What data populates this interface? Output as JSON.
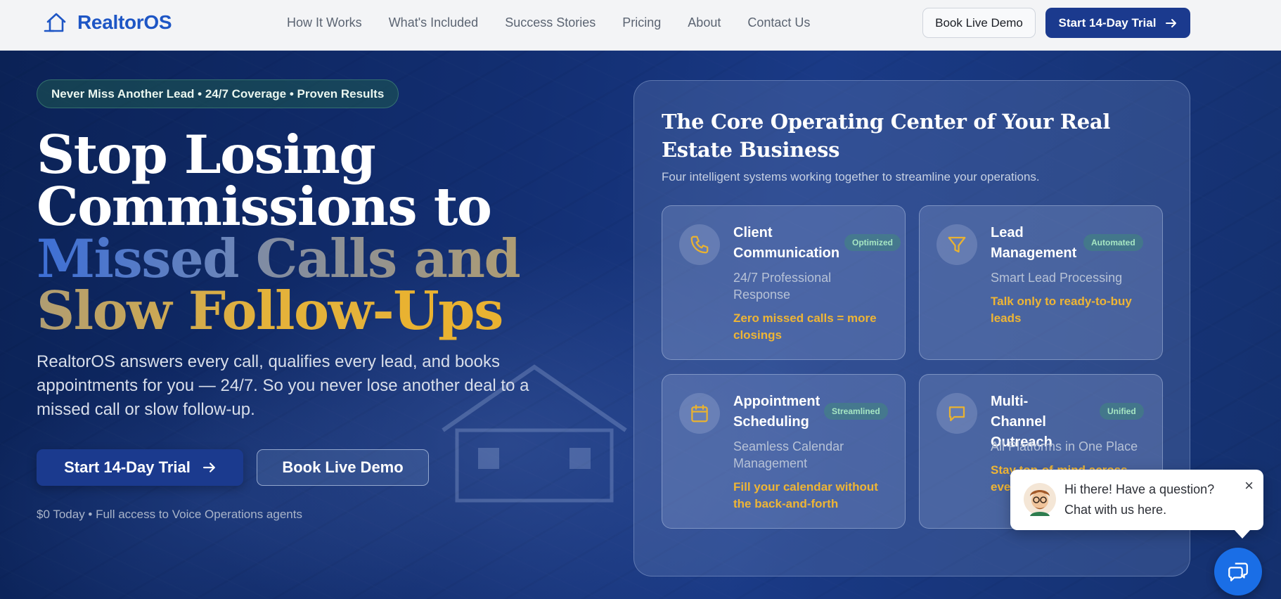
{
  "nav": {
    "brand": "RealtorOS",
    "links": [
      "How It Works",
      "What's Included",
      "Success Stories",
      "Pricing",
      "About",
      "Contact Us"
    ],
    "demo_label": "Book Live Demo",
    "trial_label": "Start 14-Day Trial"
  },
  "hero": {
    "pill": "Never Miss Another Lead • 24/7 Coverage • Proven Results",
    "headline": {
      "part1": "Stop Losing Commissions to ",
      "part2": "Missed",
      "part3": " Calls and Slow Follow-",
      "part4": "Ups"
    },
    "subtext": "RealtorOS answers every call, qualifies every lead, and books appointments for you — 24/7. So you never lose another deal to a missed call or slow follow-up.",
    "trial_label": "Start 14-Day Trial",
    "demo_label": "Book Live Demo",
    "fine_print": "$0 Today • Full access to Voice Operations agents"
  },
  "panel": {
    "title": "The Core Operating Center of Your Real Estate Business",
    "subtitle": "Four intelligent systems working together to streamline your operations.",
    "cards": [
      {
        "title": "Client Communication",
        "badge": "Optimized",
        "sub": "24/7 Professional Response",
        "benefit": "Zero missed calls = more closings",
        "icon": "phone-icon"
      },
      {
        "title": "Lead Management",
        "badge": "Automated",
        "sub": "Smart Lead Processing",
        "benefit": "Talk only to ready-to-buy leads",
        "icon": "filter-icon"
      },
      {
        "title": "Appointment Scheduling",
        "badge": "Streamlined",
        "sub": "Seamless Calendar Management",
        "benefit": "Fill your calendar without the back-and-forth",
        "icon": "calendar-icon"
      },
      {
        "title": "Multi-Channel Outreach",
        "badge": "Unified",
        "sub": "All Platforms in One Place",
        "benefit": "Stay top-of-mind across every channel",
        "icon": "message-icon"
      }
    ]
  },
  "chat": {
    "message": "Hi there! Have a question? Chat with us here.",
    "close": "×"
  },
  "colors": {
    "brand": "#1e56c5",
    "primary_button": "#1b3a8e",
    "accent_gold": "#e9b231",
    "chat_button": "#1a6ee6"
  }
}
